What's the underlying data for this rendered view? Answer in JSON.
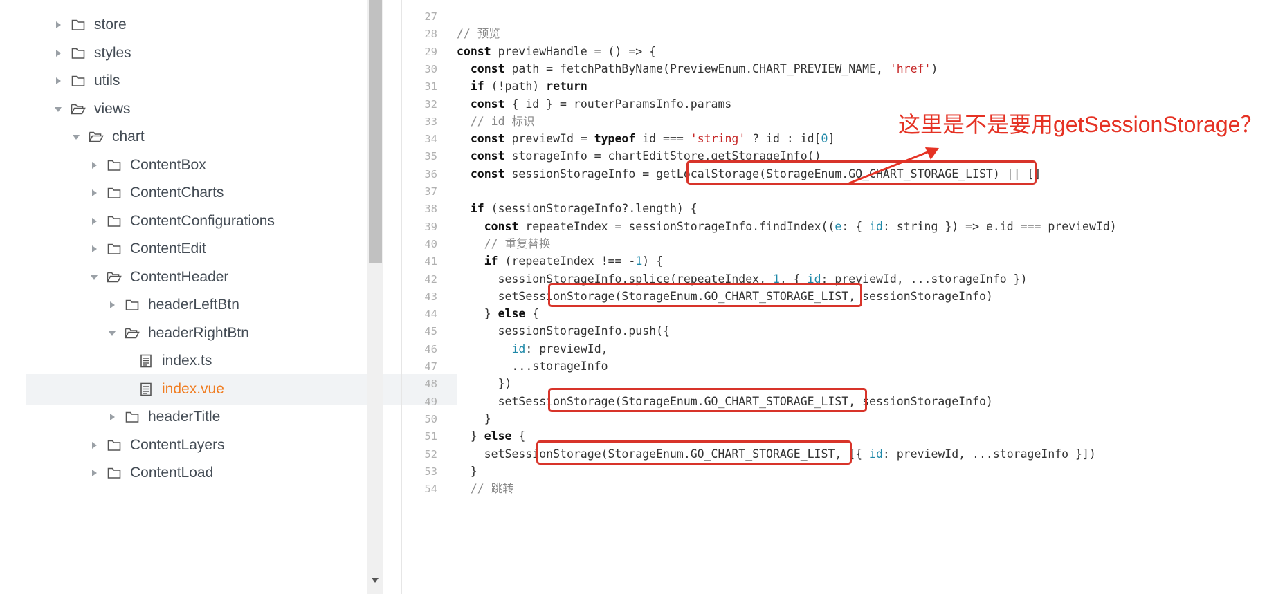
{
  "file_tree": {
    "items": [
      {
        "label": "store",
        "caret": "right",
        "folder": "closed",
        "active": false
      },
      {
        "label": "styles",
        "caret": "right",
        "folder": "closed",
        "active": false
      },
      {
        "label": "utils",
        "caret": "right",
        "folder": "closed",
        "active": false
      },
      {
        "label": "views",
        "caret": "down",
        "folder": "open",
        "active": false
      },
      {
        "label": "chart",
        "caret": "down",
        "folder": "open",
        "active": false
      },
      {
        "label": "ContentBox",
        "caret": "right",
        "folder": "closed",
        "active": false
      },
      {
        "label": "ContentCharts",
        "caret": "right",
        "folder": "closed",
        "active": false
      },
      {
        "label": "ContentConfigurations",
        "caret": "right",
        "folder": "closed",
        "active": false
      },
      {
        "label": "ContentEdit",
        "caret": "right",
        "folder": "closed",
        "active": false
      },
      {
        "label": "ContentHeader",
        "caret": "down",
        "folder": "open",
        "active": false
      },
      {
        "label": "headerLeftBtn",
        "caret": "right",
        "folder": "closed",
        "active": false
      },
      {
        "label": "headerRightBtn",
        "caret": "down",
        "folder": "open",
        "active": false
      },
      {
        "label": "index.ts",
        "caret": "none",
        "folder": "file",
        "active": false
      },
      {
        "label": "index.vue",
        "caret": "none",
        "folder": "file",
        "active": true
      },
      {
        "label": "headerTitle",
        "caret": "right",
        "folder": "closed",
        "active": false
      },
      {
        "label": "ContentLayers",
        "caret": "right",
        "folder": "closed",
        "active": false
      },
      {
        "label": "ContentLoad",
        "caret": "right",
        "folder": "closed",
        "active": false
      }
    ]
  },
  "code": {
    "lines": [
      {
        "n": "27",
        "t": ""
      },
      {
        "n": "28",
        "t": "// 预览"
      },
      {
        "n": "29",
        "t": "const previewHandle = () => {"
      },
      {
        "n": "30",
        "t": "  const path = fetchPathByName(PreviewEnum.CHART_PREVIEW_NAME, 'href')"
      },
      {
        "n": "31",
        "t": "  if (!path) return"
      },
      {
        "n": "32",
        "t": "  const { id } = routerParamsInfo.params"
      },
      {
        "n": "33",
        "t": "  // id 标识"
      },
      {
        "n": "34",
        "t": "  const previewId = typeof id === 'string' ? id : id[0]"
      },
      {
        "n": "35",
        "t": "  const storageInfo = chartEditStore.getStorageInfo()"
      },
      {
        "n": "36",
        "t": "  const sessionStorageInfo = getLocalStorage(StorageEnum.GO_CHART_STORAGE_LIST) || []"
      },
      {
        "n": "37",
        "t": ""
      },
      {
        "n": "38",
        "t": "  if (sessionStorageInfo?.length) {"
      },
      {
        "n": "39",
        "t": "    const repeateIndex = sessionStorageInfo.findIndex((e: { id: string }) => e.id === previewId)"
      },
      {
        "n": "40",
        "t": "    // 重复替换"
      },
      {
        "n": "41",
        "t": "    if (repeateIndex !== -1) {"
      },
      {
        "n": "42",
        "t": "      sessionStorageInfo.splice(repeateIndex, 1, { id: previewId, ...storageInfo })"
      },
      {
        "n": "43",
        "t": "      setSessionStorage(StorageEnum.GO_CHART_STORAGE_LIST, sessionStorageInfo)"
      },
      {
        "n": "44",
        "t": "    } else {"
      },
      {
        "n": "45",
        "t": "      sessionStorageInfo.push({"
      },
      {
        "n": "46",
        "t": "        id: previewId,"
      },
      {
        "n": "47",
        "t": "        ...storageInfo"
      },
      {
        "n": "48",
        "t": "      })"
      },
      {
        "n": "49",
        "t": "      setSessionStorage(StorageEnum.GO_CHART_STORAGE_LIST, sessionStorageInfo)"
      },
      {
        "n": "50",
        "t": "    }"
      },
      {
        "n": "51",
        "t": "  } else {"
      },
      {
        "n": "52",
        "t": "    setSessionStorage(StorageEnum.GO_CHART_STORAGE_LIST, [{ id: previewId, ...storageInfo }])"
      },
      {
        "n": "53",
        "t": "  }"
      },
      {
        "n": "54",
        "t": "  // 跳转"
      }
    ]
  },
  "annotation": {
    "text": "这里是不是要用getSessionStorage？"
  },
  "colors": {
    "highlight": "#d8342a",
    "active_file": "#f07c20"
  }
}
